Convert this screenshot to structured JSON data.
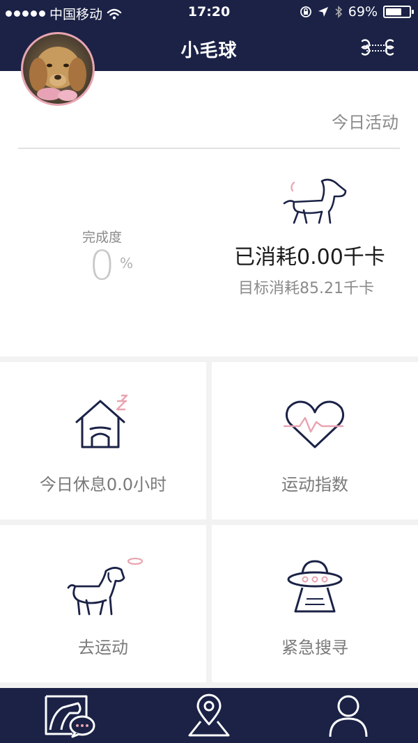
{
  "status_bar": {
    "carrier": "中国移动",
    "time": "17:20",
    "battery_text": "69%",
    "battery_level": 0.69
  },
  "header": {
    "title": "小毛球"
  },
  "activity": {
    "today_label": "今日活动",
    "completion_label": "完成度",
    "completion_value": "0",
    "completion_unit": "%",
    "calories_consumed": "已消耗0.00千卡",
    "calories_target": "目标消耗85.21千卡"
  },
  "tiles": {
    "rest": "今日休息0.0小时",
    "exercise_index": "运动指数",
    "go_exercise": "去运动",
    "emergency_search": "紧急搜寻"
  },
  "colors": {
    "navy": "#1b2246",
    "pink": "#e9a4b1",
    "text_gray": "#7a7a7a",
    "background": "#f2f2f2"
  },
  "icons": {
    "header_right": "bone-icon",
    "tab_1": "pet-chat-icon",
    "tab_2": "map-location-icon",
    "tab_3": "user-profile-icon"
  }
}
